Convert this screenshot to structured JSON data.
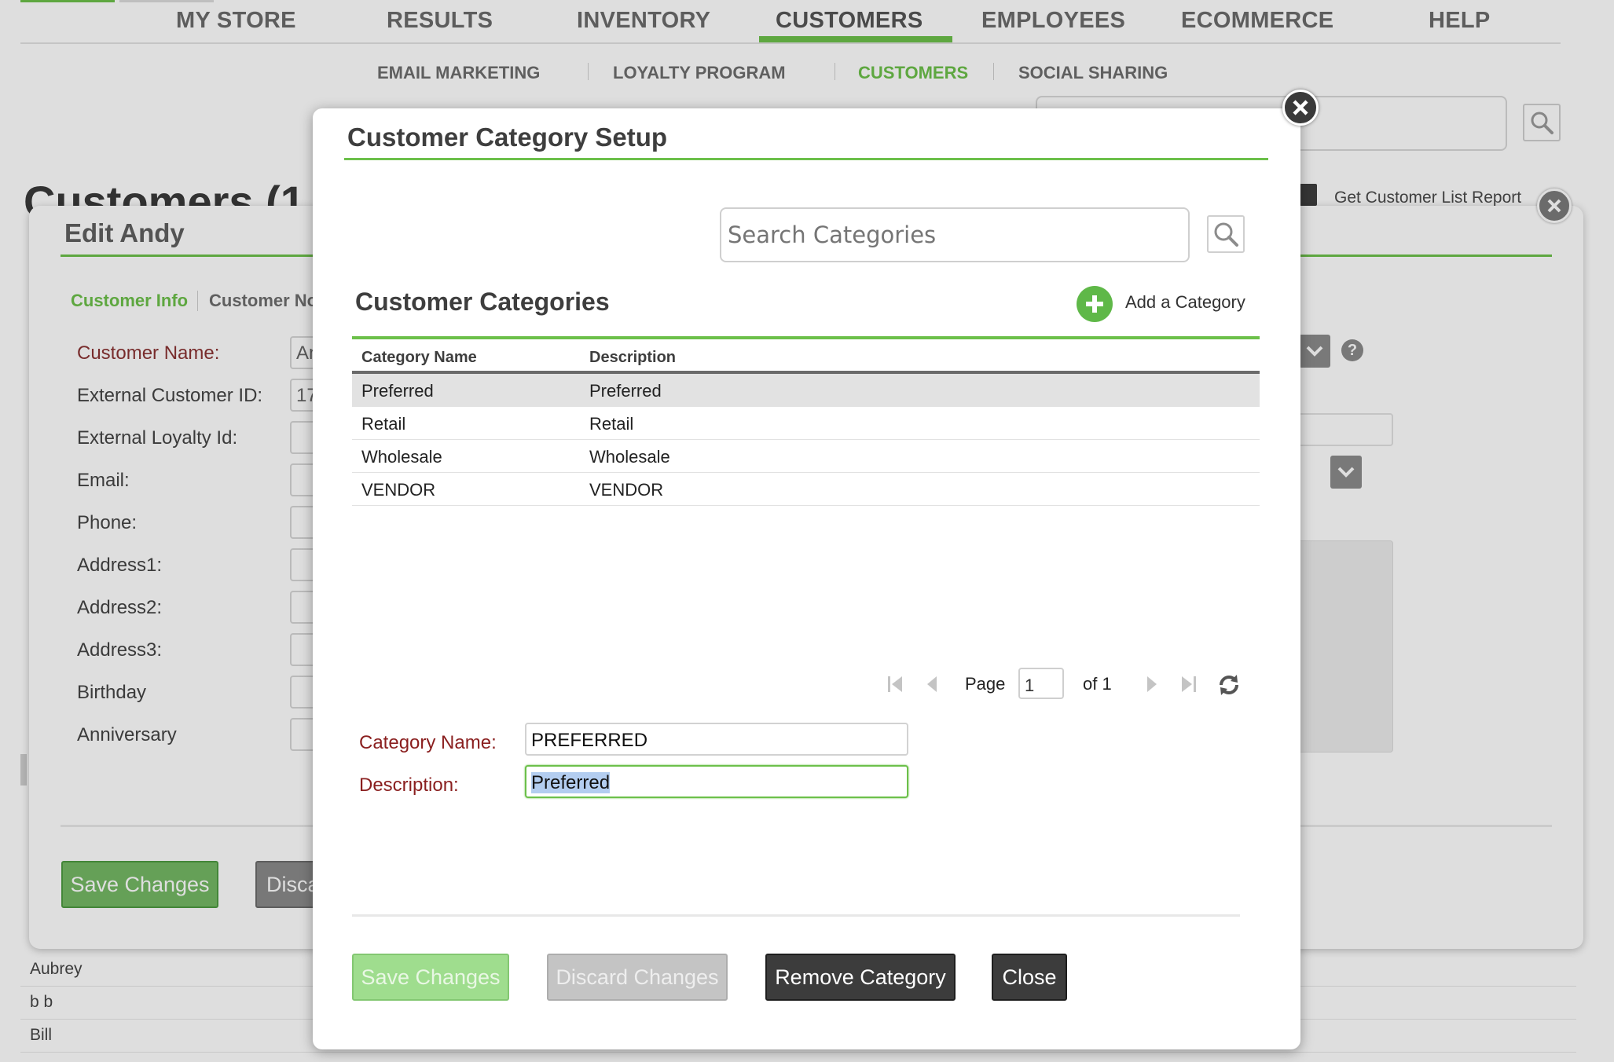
{
  "nav": {
    "items": [
      "MY STORE",
      "RESULTS",
      "INVENTORY",
      "CUSTOMERS",
      "EMPLOYEES",
      "ECOMMERCE",
      "HELP"
    ],
    "active": "CUSTOMERS"
  },
  "subnav": {
    "items": [
      "EMAIL MARKETING",
      "LOYALTY PROGRAM",
      "CUSTOMERS",
      "SOCIAL SHARING"
    ],
    "active": "CUSTOMERS"
  },
  "background": {
    "page_title": "Customers (1",
    "report_link": "Get Customer List Report",
    "list_rows": [
      "Aubrey",
      "b b",
      "Bill"
    ]
  },
  "edit_panel": {
    "title": "Edit Andy",
    "tabs": [
      "Customer Info",
      "Customer No"
    ],
    "fields": [
      {
        "label": "Customer Name:",
        "value": "An",
        "required": true
      },
      {
        "label": "External Customer ID:",
        "value": "17",
        "required": false
      },
      {
        "label": "External Loyalty Id:",
        "value": "",
        "required": false
      },
      {
        "label": "Email:",
        "value": "",
        "required": false
      },
      {
        "label": "Phone:",
        "value": "",
        "required": false
      },
      {
        "label": "Address1:",
        "value": "",
        "required": false
      },
      {
        "label": "Address2:",
        "value": "",
        "required": false
      },
      {
        "label": "Address3:",
        "value": "",
        "required": false
      },
      {
        "label": "Birthday",
        "value": "",
        "required": false
      },
      {
        "label": "Anniversary",
        "value": "",
        "required": false
      }
    ],
    "help_icon": "?",
    "save_label": "Save Changes",
    "discard_label": "Disca"
  },
  "modal": {
    "title": "Customer Category Setup",
    "search_placeholder": "Search Categories",
    "section_title": "Customer Categories",
    "add_label": "Add a Category",
    "columns": {
      "name": "Category Name",
      "description": "Description"
    },
    "rows": [
      {
        "name": "Preferred",
        "description": "Preferred",
        "selected": true
      },
      {
        "name": "Retail",
        "description": "Retail",
        "selected": false
      },
      {
        "name": "Wholesale",
        "description": "Wholesale",
        "selected": false
      },
      {
        "name": "VENDOR",
        "description": "VENDOR",
        "selected": false
      }
    ],
    "pager": {
      "page_label": "Page",
      "page": "1",
      "of_label": "of 1"
    },
    "form": {
      "name_label": "Category Name:",
      "name_value": "PREFERRED",
      "description_label": "Description:",
      "description_value": "Preferred"
    },
    "buttons": {
      "save": "Save Changes",
      "discard": "Discard Changes",
      "remove": "Remove Category",
      "close": "Close"
    }
  },
  "colors": {
    "accent_green": "#6cc04a",
    "required_red": "#8a1f1f",
    "dark_button": "#3c3c3c"
  },
  "icons": [
    "search-icon",
    "close-icon",
    "add-icon",
    "first-page-icon",
    "prev-page-icon",
    "next-page-icon",
    "last-page-icon",
    "refresh-icon",
    "chevron-down-icon",
    "help-icon",
    "report-icon"
  ]
}
